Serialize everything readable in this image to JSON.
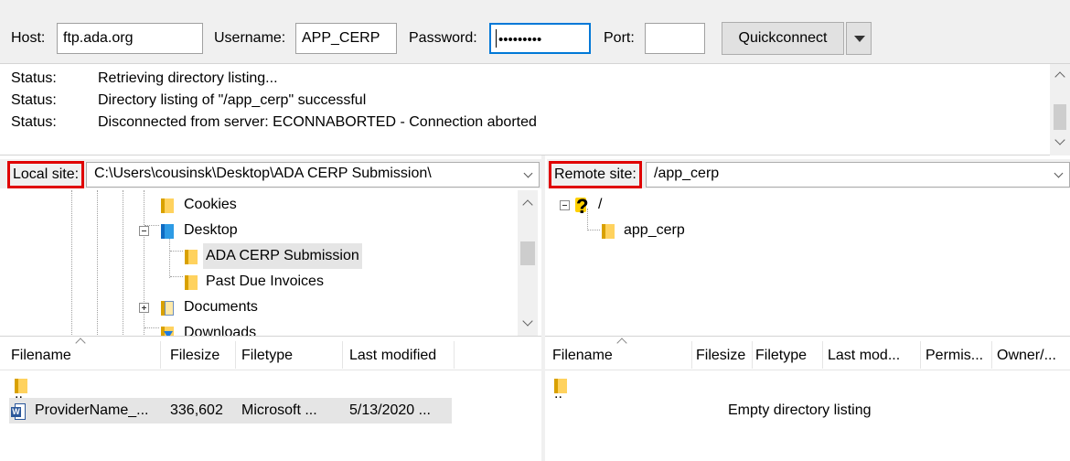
{
  "quickconnect": {
    "host_label": "Host:",
    "host_value": "ftp.ada.org",
    "username_label": "Username:",
    "username_value": "APP_CERP",
    "password_label": "Password:",
    "password_value": "•••••••••",
    "port_label": "Port:",
    "port_value": "",
    "button_label": "Quickconnect"
  },
  "log": [
    {
      "status": "Status:",
      "message": "Retrieving directory listing..."
    },
    {
      "status": "Status:",
      "message": "Directory listing of \"/app_cerp\" successful"
    },
    {
      "status": "Status:",
      "message": "Disconnected from server: ECONNABORTED - Connection aborted"
    }
  ],
  "local": {
    "label": "Local site:",
    "path": "C:\\Users\\cousinsk\\Desktop\\ADA CERP Submission\\",
    "tree": [
      {
        "name": "Cookies",
        "icon": "folder-icon"
      },
      {
        "name": "Desktop",
        "icon": "desktop-folder-icon"
      },
      {
        "name": "ADA CERP Submission",
        "icon": "folder-icon",
        "selected": true
      },
      {
        "name": "Past Due Invoices",
        "icon": "folder-icon"
      },
      {
        "name": "Documents",
        "icon": "documents-folder-icon"
      },
      {
        "name": "Downloads",
        "icon": "downloads-folder-icon"
      }
    ],
    "columns": [
      "Filename",
      "Filesize",
      "Filetype",
      "Last modified"
    ],
    "parent_dir": "..",
    "files": [
      {
        "name": "ProviderName_...",
        "size": "336,602",
        "type": "Microsoft ...",
        "modified": "5/13/2020 ..."
      }
    ]
  },
  "remote": {
    "label": "Remote site:",
    "path": "/app_cerp",
    "tree": [
      {
        "name": "/",
        "icon": "unknown-folder-icon"
      },
      {
        "name": "app_cerp",
        "icon": "folder-icon"
      }
    ],
    "columns": [
      "Filename",
      "Filesize",
      "Filetype",
      "Last mod...",
      "Permis...",
      "Owner/..."
    ],
    "parent_dir": "..",
    "empty_message": "Empty directory listing"
  },
  "colors": {
    "highlight_box": "#e00000",
    "selection": "#e5e5e5",
    "focus_border": "#0078d7"
  }
}
